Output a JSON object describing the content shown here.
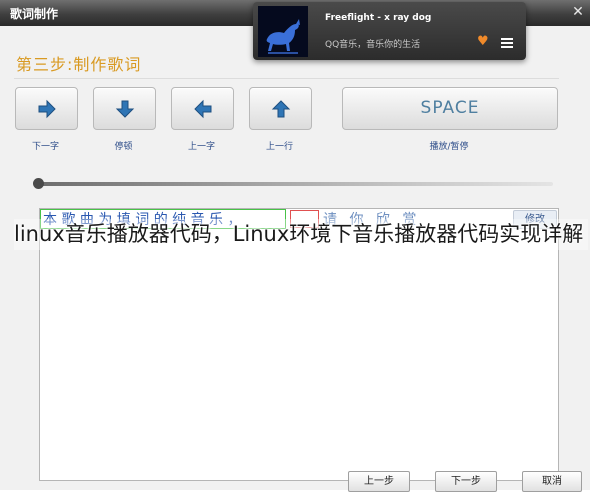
{
  "window": {
    "title": "歌词制作",
    "close_glyph": "✕"
  },
  "step": {
    "title": "第三步:制作歌词"
  },
  "controls": {
    "buttons": [
      {
        "icon": "arrow-right-icon",
        "label": "下一字"
      },
      {
        "icon": "arrow-down-icon",
        "label": "停顿"
      },
      {
        "icon": "arrow-left-icon",
        "label": "上一字"
      },
      {
        "icon": "arrow-up-icon",
        "label": "上一行"
      }
    ],
    "space_button": "SPACE",
    "space_label": "播放/暂停"
  },
  "lyrics": {
    "completed_text": "本 歌 曲 为 填 词 的 纯 音 乐 ，",
    "pending_text": "请 你 欣 赏",
    "edit_button": "修改"
  },
  "footer": {
    "prev_button": "上一步",
    "next_button": "下一步",
    "cancel_button": "取消"
  },
  "overlay_caption": "linux音乐播放器代码，Linux环境下音乐播放器代码实现详解",
  "notification": {
    "track_title": "Freeflight - x ray dog",
    "subtitle": "QQ音乐，音乐你的生活",
    "heart_glyph": "♥"
  },
  "colors": {
    "step_title": "#d99a22",
    "lyric_done": "#2a58b0",
    "lyric_frame": "#47c247",
    "cursor_frame": "#e05050",
    "control_label": "#2f4e8a",
    "space_text": "#4f7fa0",
    "heart": "#f08a2a"
  }
}
